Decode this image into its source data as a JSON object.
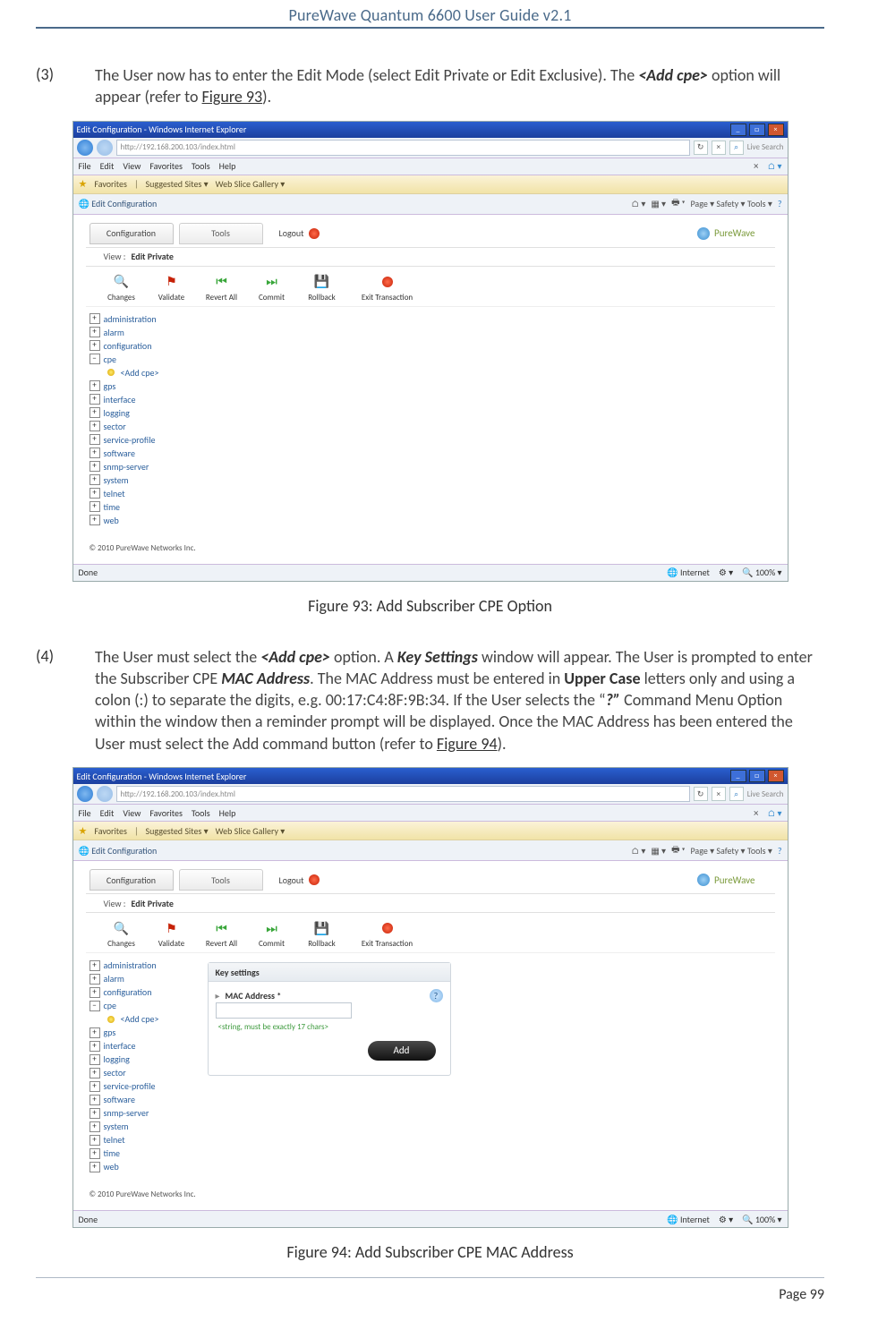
{
  "doc": {
    "header_title": "PureWave Quantum 6600 User Guide v2.1",
    "page_label": "Page 99"
  },
  "step3": {
    "num": "(3)",
    "text_a": "The User now has to enter the Edit Mode (select Edit Private or Edit Exclusive). The ",
    "add_cpe": "<Add cpe>",
    "text_b": " option will appear (refer to ",
    "fig_link": "Figure 93",
    "text_c": ")."
  },
  "fig93_caption": "Figure 93: Add Subscriber CPE Option",
  "step4": {
    "num": "(4)",
    "a": "The User must select the ",
    "add_cpe": "<Add cpe>",
    "b": " option. A ",
    "key_settings": "Key Settings",
    "c": " window will appear. The User is prompted to enter the Subscriber CPE ",
    "mac": "MAC Address",
    "d": ". The MAC Address must be entered in ",
    "upper": "Upper Case",
    "e": " letters only and using a colon (:) to separate the digits, e.g. 00:17:C4:8F:9B:34. If the User selects the “",
    "q": "?”",
    "f": " Command Menu Option within the window then a reminder prompt will be displayed. Once the MAC Address has been entered the User must select the Add command button (refer to ",
    "fig_link": "Figure 94",
    "g": ")."
  },
  "fig94_caption": "Figure 94: Add Subscriber CPE MAC Address",
  "ie": {
    "title": "Edit Configuration - Windows Internet Explorer",
    "url": "http://192.168.200.103/index.html",
    "menu": [
      "File",
      "Edit",
      "View",
      "Favorites",
      "Tools",
      "Help"
    ],
    "fav_label": "Favorites",
    "fav_suggested": "Suggested Sites ▾",
    "fav_slice": "Web Slice Gallery ▾",
    "tabname": "Edit Configuration",
    "page_tools": "Page ▾   Safety ▾   Tools ▾",
    "live_search": "Live Search",
    "status_done": "Done",
    "status_internet": "Internet",
    "status_zoom": "100%   ▾"
  },
  "pw": {
    "tab_config": "Configuration",
    "tab_tools": "Tools",
    "logout": "Logout",
    "logo": "PureWave",
    "view": "View :",
    "view_mode": "Edit Private",
    "tools": {
      "changes": "Changes",
      "validate": "Validate",
      "revert": "Revert All",
      "commit": "Commit",
      "rollback": "Rollback",
      "exit": "Exit Transaction"
    },
    "tree": {
      "administration": "administration",
      "alarm": "alarm",
      "configuration": "configuration",
      "cpe": "cpe",
      "add_cpe": "<Add cpe>",
      "gps": "gps",
      "interface": "interface",
      "logging": "logging",
      "sector": "sector",
      "service_profile": "service-profile",
      "software": "software",
      "snmp_server": "snmp-server",
      "system": "system",
      "telnet": "telnet",
      "time": "time",
      "web": "web"
    },
    "copyright": "© 2010 PureWave Networks Inc.",
    "panel": {
      "title": "Key settings",
      "mac_label": "MAC Address *",
      "hint": "<string, must be exactly 17 chars>",
      "add": "Add"
    }
  }
}
